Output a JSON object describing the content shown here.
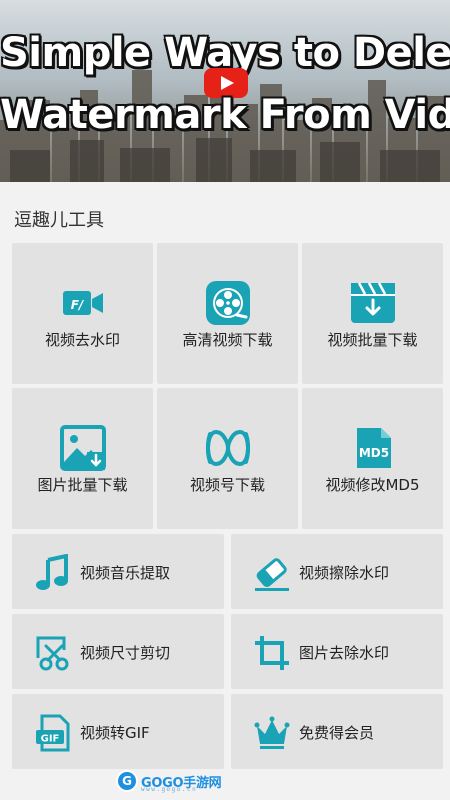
{
  "banner": {
    "line1": "Simple Ways to Delete",
    "line2": "Watermark From Video"
  },
  "section": {
    "title": "逗趣儿工具"
  },
  "tools_grid": [
    {
      "label": "视频去水印",
      "icon": "video-watermark-icon"
    },
    {
      "label": "高清视频下载",
      "icon": "film-reel-icon"
    },
    {
      "label": "视频批量下载",
      "icon": "clapper-download-icon"
    },
    {
      "label": "图片批量下载",
      "icon": "image-download-icon"
    },
    {
      "label": "视频号下载",
      "icon": "infinity-loop-icon"
    },
    {
      "label": "视频修改MD5",
      "icon": "md5-file-icon"
    }
  ],
  "tools_list": [
    {
      "label": "视频音乐提取",
      "icon": "music-note-icon"
    },
    {
      "label": "视频擦除水印",
      "icon": "eraser-icon"
    },
    {
      "label": "视频尺寸剪切",
      "icon": "scissors-icon"
    },
    {
      "label": "图片去除水印",
      "icon": "crop-icon"
    },
    {
      "label": "视频转GIF",
      "icon": "gif-file-icon"
    },
    {
      "label": "免费得会员",
      "icon": "crown-icon"
    }
  ],
  "icons": {
    "md5_text": "MD5",
    "gif_text": "GIF"
  },
  "watermark": {
    "badge": "G",
    "text": "GOGO手游网",
    "sub": "www.gogo.cn"
  },
  "colors": {
    "accent": "#1aa3b5",
    "tile_bg": "#e2e2e2",
    "page_bg": "#f2f2f2"
  }
}
